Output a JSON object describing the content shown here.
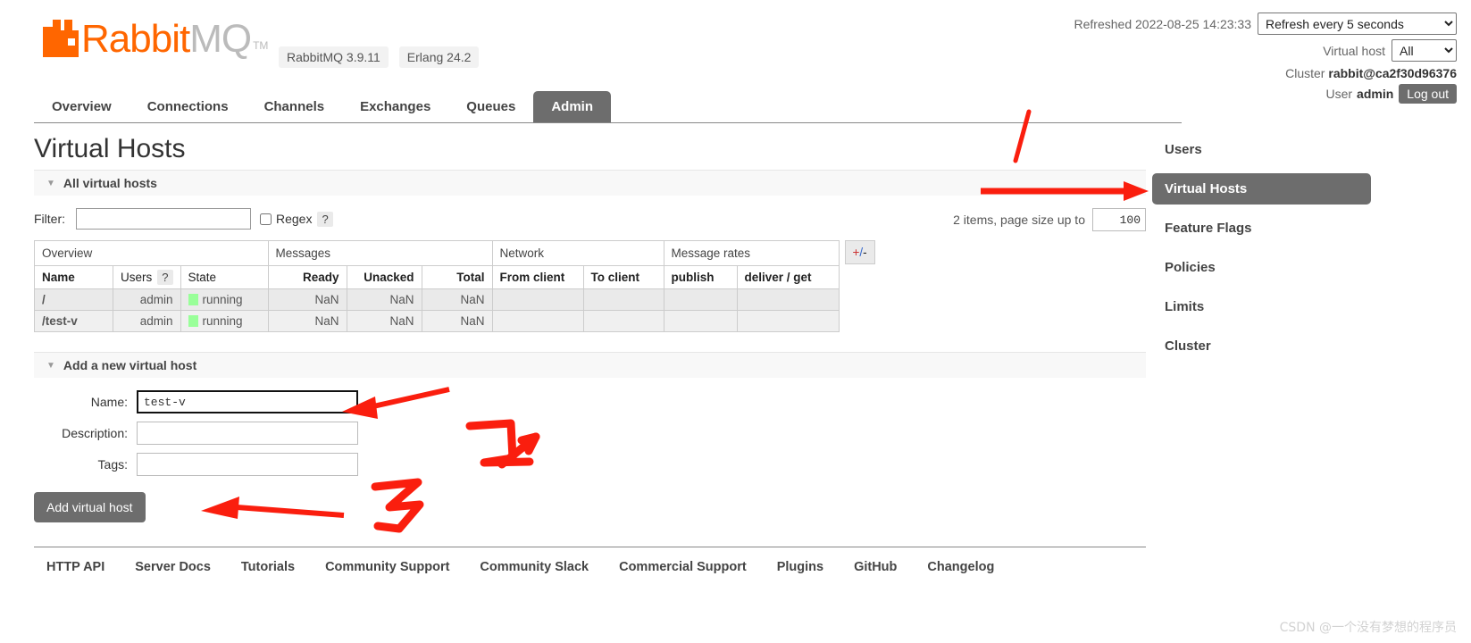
{
  "header": {
    "logo_rabbit": "Rabbit",
    "logo_mq": "MQ",
    "logo_tm": "TM",
    "badges": [
      "RabbitMQ 3.9.11",
      "Erlang 24.2"
    ],
    "refreshed_label": "Refreshed 2022-08-25 14:23:33",
    "refresh_select_value": "Refresh every 5 seconds",
    "refresh_options": [
      "Refresh every 5 seconds"
    ],
    "vhost_label": "Virtual host",
    "vhost_select_value": "All",
    "vhost_options": [
      "All"
    ],
    "cluster_label": "Cluster",
    "cluster_value": "rabbit@ca2f30d96376",
    "user_label": "User",
    "user_value": "admin",
    "logout_label": "Log out"
  },
  "nav": {
    "tabs": [
      {
        "label": "Overview",
        "active": false
      },
      {
        "label": "Connections",
        "active": false
      },
      {
        "label": "Channels",
        "active": false
      },
      {
        "label": "Exchanges",
        "active": false
      },
      {
        "label": "Queues",
        "active": false
      },
      {
        "label": "Admin",
        "active": true
      }
    ]
  },
  "main": {
    "page_title": "Virtual Hosts",
    "all_vhosts_section": "All virtual hosts",
    "filter_label": "Filter:",
    "filter_value": "",
    "regex_label": "Regex",
    "help_badge": "?",
    "pager_text": "2 items, page size up to",
    "page_size_value": "100",
    "plus_minus": {
      "plus": "+",
      "slash": "/",
      "minus": "-"
    },
    "table": {
      "group_headers": [
        {
          "label": "Overview",
          "span": 3
        },
        {
          "label": "Messages",
          "span": 3
        },
        {
          "label": "Network",
          "span": 2
        },
        {
          "label": "Message rates",
          "span": 2
        }
      ],
      "columns": [
        "Name",
        "Users",
        "State",
        "Ready",
        "Unacked",
        "Total",
        "From client",
        "To client",
        "publish",
        "deliver / get"
      ],
      "users_help": "?",
      "rows": [
        {
          "name": "/",
          "users": "admin",
          "state": "running",
          "ready": "NaN",
          "unacked": "NaN",
          "total": "NaN",
          "from_client": "",
          "to_client": "",
          "publish": "",
          "deliver_get": ""
        },
        {
          "name": "/test-v",
          "users": "admin",
          "state": "running",
          "ready": "NaN",
          "unacked": "NaN",
          "total": "NaN",
          "from_client": "",
          "to_client": "",
          "publish": "",
          "deliver_get": ""
        }
      ]
    },
    "add_form": {
      "section_title": "Add a new virtual host",
      "name_label": "Name:",
      "name_value": "test-v",
      "description_label": "Description:",
      "description_value": "",
      "tags_label": "Tags:",
      "tags_value": "",
      "submit_label": "Add virtual host"
    }
  },
  "sidebar": {
    "items": [
      {
        "label": "Users",
        "active": false
      },
      {
        "label": "Virtual Hosts",
        "active": true
      },
      {
        "label": "Feature Flags",
        "active": false
      },
      {
        "label": "Policies",
        "active": false
      },
      {
        "label": "Limits",
        "active": false
      },
      {
        "label": "Cluster",
        "active": false
      }
    ]
  },
  "footer": {
    "links": [
      "HTTP API",
      "Server Docs",
      "Tutorials",
      "Community Support",
      "Community Slack",
      "Commercial Support",
      "Plugins",
      "GitHub",
      "Changelog"
    ]
  },
  "annotations": {
    "color": "#fa1e0e",
    "marks": [
      "1",
      "2",
      "3"
    ]
  },
  "watermark": "CSDN @一个没有梦想的程序员",
  "colors": {
    "brand_orange": "#ff6600",
    "active_gray": "#6d6d6d",
    "state_green": "#99ff99",
    "annotation_red": "#fa1e0e"
  }
}
